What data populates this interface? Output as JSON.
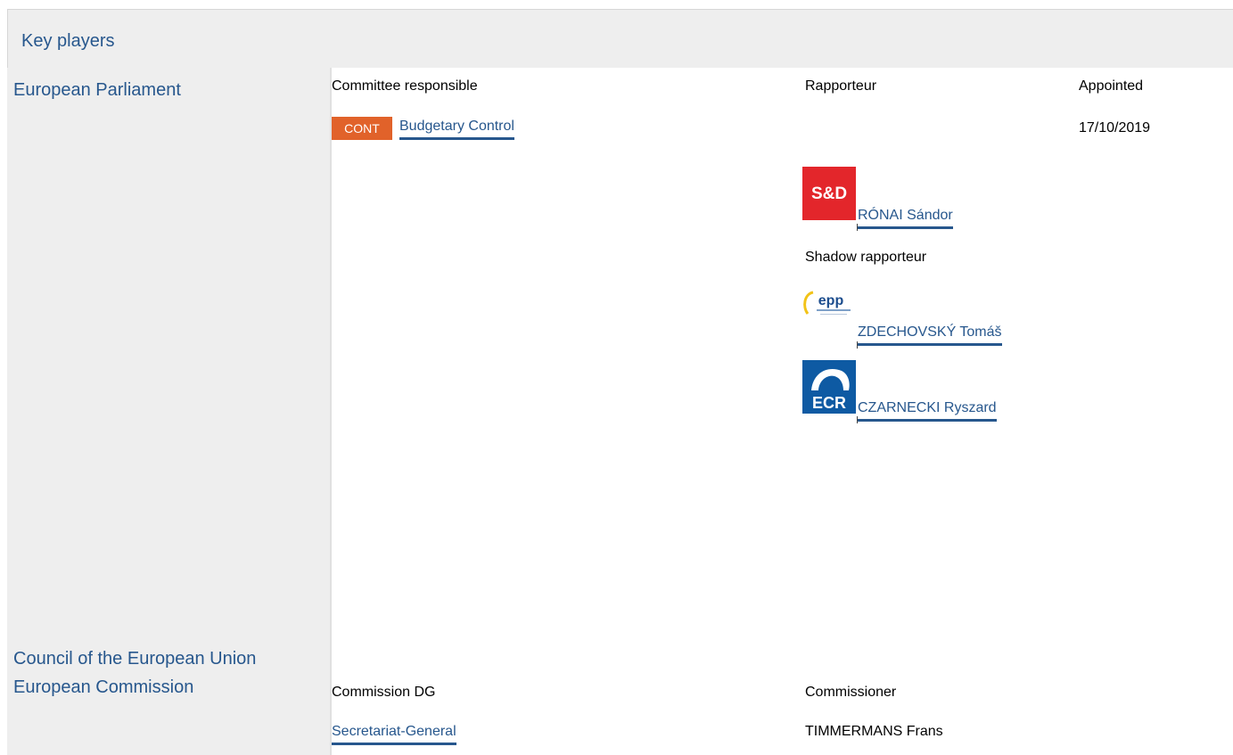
{
  "section": {
    "title": "Key players"
  },
  "parliament": {
    "name": "European Parliament",
    "committee_header": "Committee responsible",
    "rapporteur_header": "Rapporteur",
    "appointed_header": "Appointed",
    "committee_code": "CONT",
    "committee_name": "Budgetary Control",
    "appointed_date": "17/10/2019",
    "rapporteur": {
      "group_logo": "S&D",
      "name": "RÓNAI Sándor"
    },
    "shadow_header": "Shadow rapporteur",
    "shadows": [
      {
        "group_logo": "epp",
        "name": "ZDECHOVSKÝ Tomáš"
      },
      {
        "group_logo": "ECR",
        "name": "CZARNECKI Ryszard"
      }
    ]
  },
  "council": {
    "name": "Council of the European Union"
  },
  "commission": {
    "name": "European Commission",
    "dg_header": "Commission DG",
    "commissioner_header": "Commissioner",
    "dg_name": "Secretariat-General",
    "commissioner_name": "TIMMERMANS Frans"
  },
  "colors": {
    "accent_blue": "#27578d",
    "cont_badge": "#e1622a",
    "sd_red": "#e3262b",
    "ecr_blue": "#0e5aa3",
    "panel_grey": "#eeeeee"
  }
}
